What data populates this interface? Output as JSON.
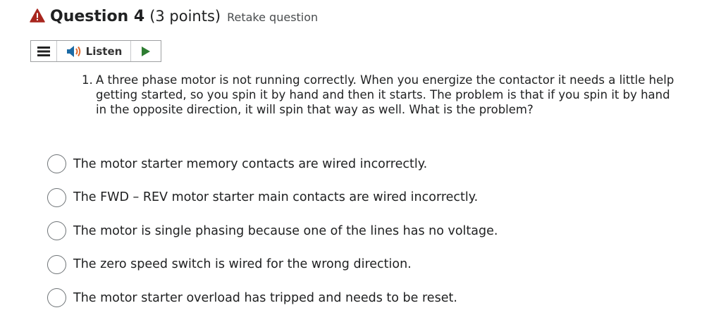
{
  "header": {
    "title": "Question 4",
    "points": "(3 points)",
    "retake": "Retake question",
    "warning_color": "#a8261e"
  },
  "listen_bar": {
    "menu_icon": "hamburger-menu-icon",
    "speaker_icon": "speaker-icon",
    "listen_label": "Listen",
    "play_icon": "play-icon",
    "play_color": "#2e7d32"
  },
  "question": {
    "number": "1.",
    "text": "A three phase motor is not running correctly.  When you energize the contactor it needs a little help getting started, so you spin it by hand and then it starts.  The problem is that if you spin it by hand in the opposite direction, it will spin that way as well.  What is the problem?"
  },
  "options": [
    {
      "label": "The motor starter memory contacts are wired incorrectly."
    },
    {
      "label": "The FWD – REV motor starter main contacts are wired incorrectly."
    },
    {
      "label": "The motor is single phasing because one of the lines has no voltage."
    },
    {
      "label": "The zero speed switch is wired for the wrong direction."
    },
    {
      "label": "The motor starter overload has tripped and needs to be reset."
    }
  ]
}
